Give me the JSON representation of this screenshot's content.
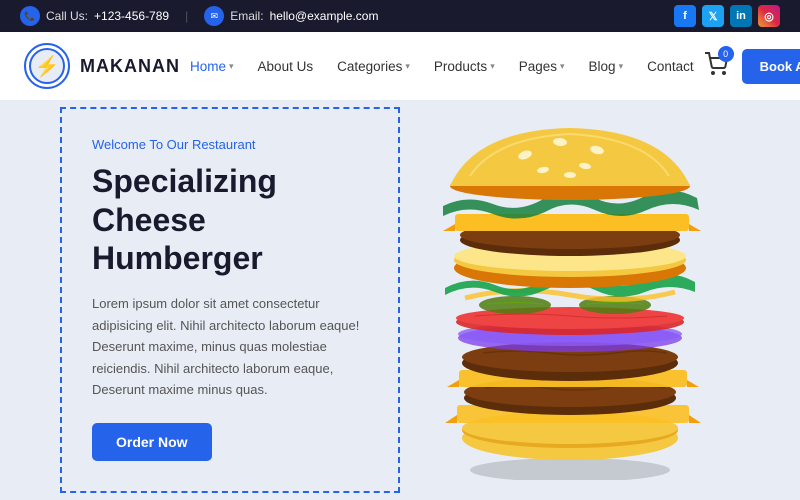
{
  "topbar": {
    "call_label": "Call Us:",
    "call_number": "+123-456-789",
    "email_label": "Email:",
    "email_address": "hello@example.com",
    "social": [
      {
        "name": "Facebook",
        "abbr": "f",
        "class": "social-fb"
      },
      {
        "name": "Twitter",
        "abbr": "t",
        "class": "social-tw"
      },
      {
        "name": "LinkedIn",
        "abbr": "in",
        "class": "social-li"
      },
      {
        "name": "Instagram",
        "abbr": "ig",
        "class": "social-ig"
      }
    ]
  },
  "header": {
    "logo_text": "MAKANAN",
    "cart_count": "0",
    "book_button": "Book A Table",
    "nav": [
      {
        "label": "Home",
        "has_dropdown": true,
        "active": true
      },
      {
        "label": "About Us",
        "has_dropdown": false,
        "active": false
      },
      {
        "label": "Categories",
        "has_dropdown": true,
        "active": false
      },
      {
        "label": "Products",
        "has_dropdown": true,
        "active": false
      },
      {
        "label": "Pages",
        "has_dropdown": true,
        "active": false
      },
      {
        "label": "Blog",
        "has_dropdown": true,
        "active": false
      },
      {
        "label": "Contact",
        "has_dropdown": false,
        "active": false
      }
    ]
  },
  "hero": {
    "subtitle": "Welcome To Our Restaurant",
    "title": "Specializing Cheese Humberger",
    "description": "Lorem ipsum dolor sit amet consectetur adipisicing elit. Nihil architecto laborum eaque! Deserunt maxime, minus quas molestiae reiciendis. Nihil architecto laborum eaque, Deserunt maxime minus quas.",
    "cta_button": "Order Now"
  }
}
